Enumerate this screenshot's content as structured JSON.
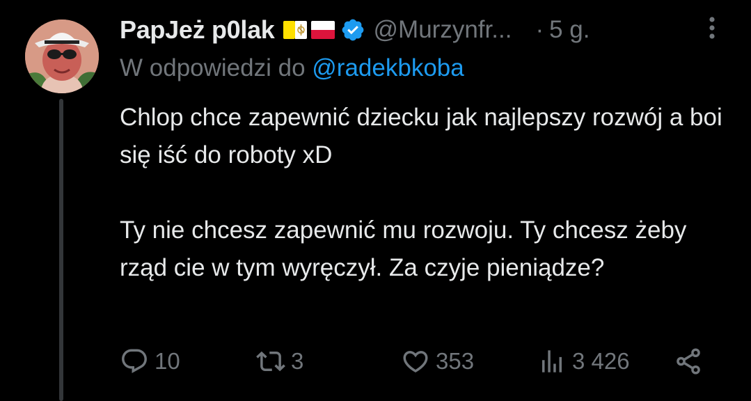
{
  "author": {
    "display_name": "PapJeż p0lak",
    "flags": [
      "vatican-flag",
      "poland-flag"
    ],
    "verified_icon": "verified-badge-icon",
    "handle": "@Murzynfr...",
    "separator": "·",
    "time": "5 g."
  },
  "reply_context": {
    "prefix": "W odpowiedzi do",
    "mention": "@radekbkoba"
  },
  "tweet": {
    "paragraphs": [
      "Chlop chce zapewnić dziecku jak najlepszy rozwój a boi się iść do roboty xD",
      "Ty nie chcesz zapewnić mu rozwoju. Ty chcesz żeby rząd cie w tym wyręczył. Za czyje pieniądze?"
    ]
  },
  "actions": {
    "reply": {
      "icon": "reply-icon",
      "count": "10"
    },
    "repost": {
      "icon": "repost-icon",
      "count": "3"
    },
    "like": {
      "icon": "heart-icon",
      "count": "353"
    },
    "views": {
      "icon": "views-icon",
      "count": "3 426"
    },
    "share": {
      "icon": "share-icon"
    }
  },
  "colors": {
    "background": "#000000",
    "text": "#e7e9ea",
    "muted": "#71767b",
    "accent": "#1d9bf0",
    "thread_line": "#333639"
  }
}
